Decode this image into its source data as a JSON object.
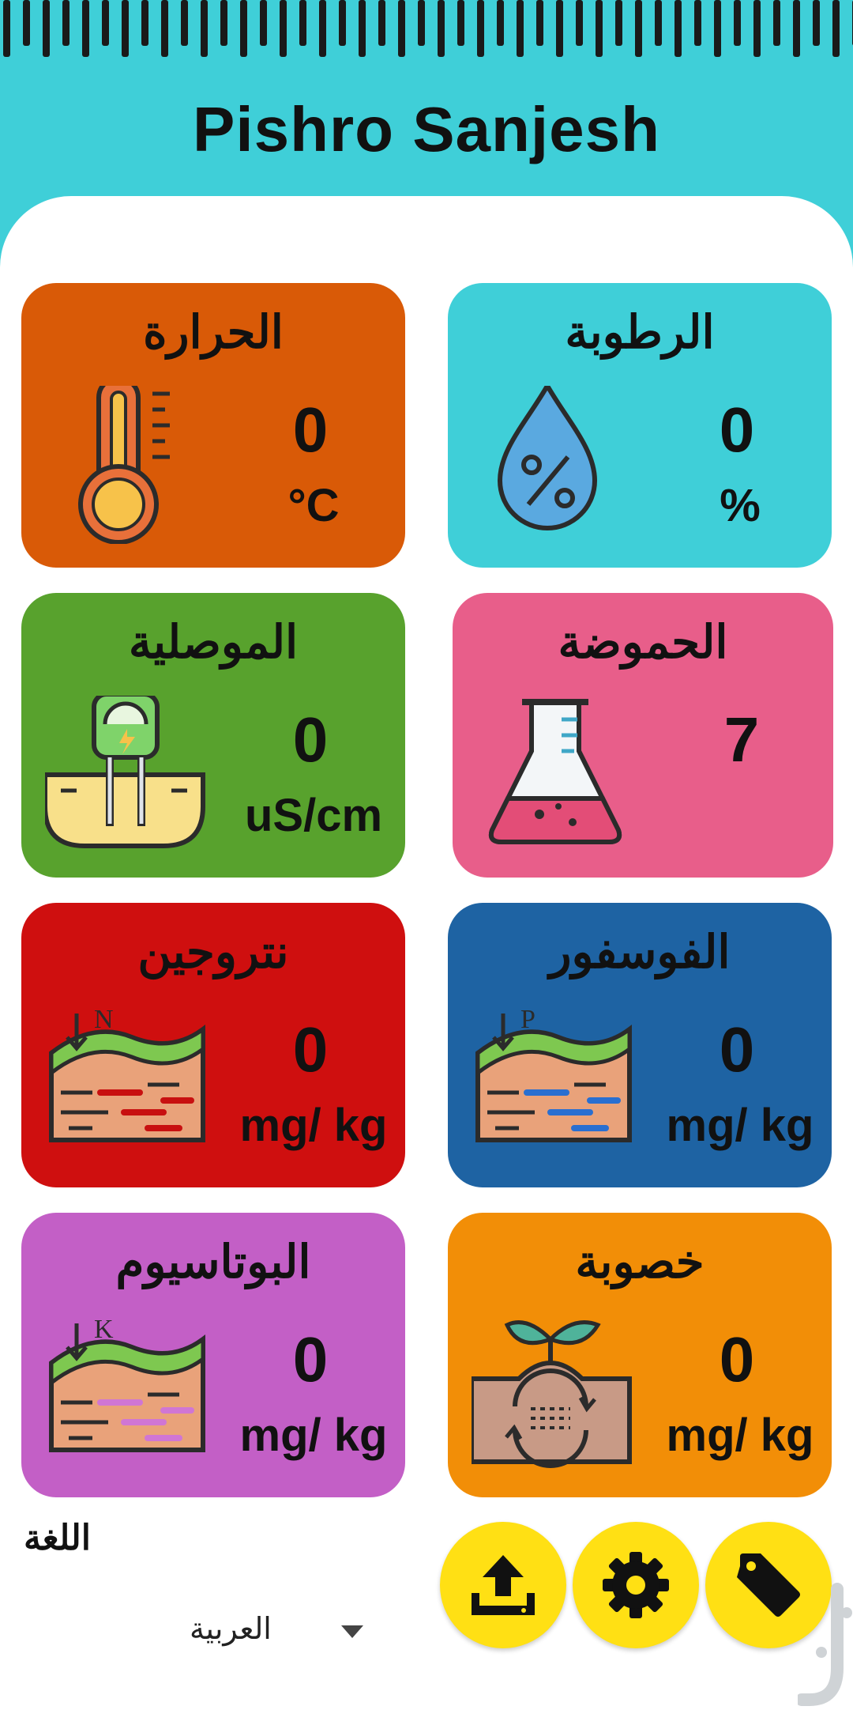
{
  "app": {
    "title": "Pishro Sanjesh"
  },
  "cards": {
    "temperature": {
      "label": "الحرارة",
      "value": "0",
      "unit": "°C",
      "color": "#d95a07"
    },
    "humidity": {
      "label": "الرطوبة",
      "value": "0",
      "unit": "%",
      "color": "#3fcfd8"
    },
    "conductivity": {
      "label": "الموصلية",
      "value": "0",
      "unit": "uS/cm",
      "color": "#58a22d"
    },
    "acidity": {
      "label": "الحموضة",
      "value": "7",
      "unit": "",
      "color": "#e85e8a"
    },
    "nitrogen": {
      "label": "نتروجين",
      "value": "0",
      "unit": "mg/ kg",
      "color": "#cf0f0f"
    },
    "phosphorus": {
      "label": "الفوسفور",
      "value": "0",
      "unit": "mg/ kg",
      "color": "#1e63a3"
    },
    "potassium": {
      "label": "البوتاسيوم",
      "value": "0",
      "unit": "mg/ kg",
      "color": "#c35fc6"
    },
    "fertility": {
      "label": "خصوبة",
      "value": "0",
      "unit": "mg/ kg",
      "color": "#f28e07"
    }
  },
  "language": {
    "label": "اللغة",
    "selected": "العربية"
  },
  "icon_letters": {
    "nitrogen": "N",
    "phosphorus": "P",
    "potassium": "K"
  },
  "actions": {
    "upload_icon": "upload-icon",
    "settings_icon": "gear-icon",
    "tag_icon": "tag-icon",
    "color": "#ffe014"
  }
}
